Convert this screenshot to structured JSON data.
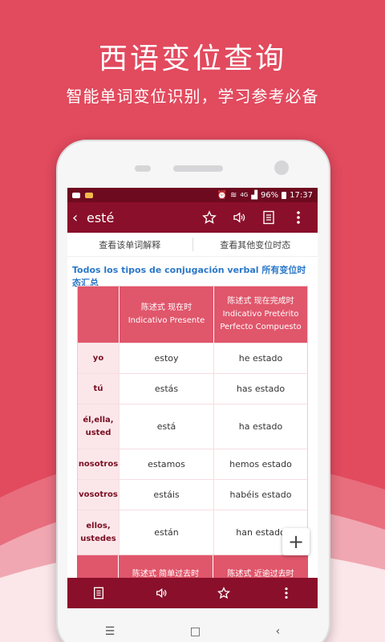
{
  "hero": {
    "title": "西语变位查询",
    "subtitle": "智能单词变位识别，学习参考必备"
  },
  "statusbar": {
    "signal": "4G",
    "battery": "96%",
    "time": "17:37"
  },
  "appbar": {
    "back_icon": "chevron-left-icon",
    "title": "esté"
  },
  "tabs": [
    {
      "label": "查看该单词解释"
    },
    {
      "label": "查看其他变位时态"
    }
  ],
  "section_title": "Todos los tipos de conjugación verbal 所有变位时态汇总",
  "table": {
    "headers": [
      {
        "cn": "陈述式 现在时",
        "es": "Indicativo Presente"
      },
      {
        "cn": "陈述式 现在完成时",
        "es_line1": "Indicativo Pretérito",
        "es_line2": "Perfecto Compuesto"
      }
    ],
    "rows": [
      {
        "pron": "yo",
        "v1": "estoy",
        "v2": "he estado"
      },
      {
        "pron": "tú",
        "v1": "estás",
        "v2": "has estado"
      },
      {
        "pron_line1": "él,ella,",
        "pron_line2": "usted",
        "v1": "está",
        "v2": "ha estado"
      },
      {
        "pron": "nosotros",
        "v1": "estamos",
        "v2": "hemos estado"
      },
      {
        "pron": "vosotros",
        "v1": "estáis",
        "v2": "habéis estado"
      },
      {
        "pron_line1": "ellos,",
        "pron_line2": "ustedes",
        "v1": "están",
        "v2": "han estado"
      }
    ],
    "next_headers": [
      "陈述式 简单过去时",
      "陈述式 近逾过去时"
    ]
  },
  "fab": {
    "label": "+"
  },
  "bottom_icons": [
    "list-icon",
    "speaker-icon",
    "star-icon",
    "more-vert-icon"
  ],
  "navbar": {
    "menu": "☰",
    "home": "□",
    "back": "‹"
  },
  "colors": {
    "background": "#e24a5e",
    "appbar": "#8a0f2a",
    "statusbar": "#6e0a20",
    "header_cell": "#e0566b",
    "pronoun_bg": "#fbe7ea",
    "link": "#2b78c8"
  }
}
